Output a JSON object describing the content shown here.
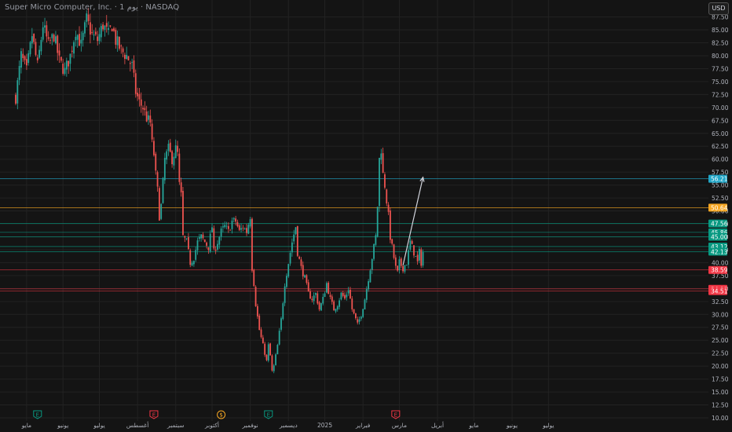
{
  "header": {
    "title": "Super Micro Computer, Inc. · 1 يوم · NASDAQ",
    "currency": "USD"
  },
  "colors": {
    "background": "#141414",
    "up": "#26a69a",
    "down": "#ef5350",
    "grid": "#222222",
    "axis_text": "#b2b5be",
    "label_cyan": "#21a6c7",
    "label_orange": "#f5a623",
    "label_green": "#089981",
    "label_red": "#f23645",
    "arrow": "#d1d4dc"
  },
  "chart_data": {
    "type": "candlestick",
    "ylim": [
      10,
      88.5
    ],
    "y_ticks": [
      {
        "value": 87.5,
        "label": "87.50"
      },
      {
        "value": 85,
        "label": "85.00"
      },
      {
        "value": 82.5,
        "label": "82.50"
      },
      {
        "value": 80,
        "label": "80.00"
      },
      {
        "value": 77.5,
        "label": "77.50"
      },
      {
        "value": 75,
        "label": "75.00"
      },
      {
        "value": 72.5,
        "label": "72.50"
      },
      {
        "value": 70,
        "label": "70.00"
      },
      {
        "value": 67.5,
        "label": "67.50"
      },
      {
        "value": 65,
        "label": "65.00"
      },
      {
        "value": 62.5,
        "label": "62.50"
      },
      {
        "value": 60,
        "label": "60.00"
      },
      {
        "value": 57.5,
        "label": "57.50"
      },
      {
        "value": 55,
        "label": "55.00"
      },
      {
        "value": 52.5,
        "label": "52.50"
      },
      {
        "value": 50,
        "label": "50.00"
      },
      {
        "value": 47.5,
        "label": "47.50"
      },
      {
        "value": 45,
        "label": "45.00"
      },
      {
        "value": 42.5,
        "label": "42.50"
      },
      {
        "value": 40,
        "label": "40.00"
      },
      {
        "value": 37.5,
        "label": "37.50"
      },
      {
        "value": 35,
        "label": "35.00"
      },
      {
        "value": 32.5,
        "label": "32.50"
      },
      {
        "value": 30,
        "label": "30.00"
      },
      {
        "value": 27.5,
        "label": "27.50"
      },
      {
        "value": 25,
        "label": "25.00"
      },
      {
        "value": 22.5,
        "label": "22.50"
      },
      {
        "value": 20,
        "label": "20.00"
      },
      {
        "value": 17.5,
        "label": "17.50"
      },
      {
        "value": 15,
        "label": "15.00"
      },
      {
        "value": 12.5,
        "label": "12.50"
      },
      {
        "value": 10,
        "label": "10.00"
      }
    ],
    "x_ticks": [
      {
        "label": "مايو",
        "i": 6
      },
      {
        "label": "يونيو",
        "i": 26
      },
      {
        "label": "يوليو",
        "i": 46
      },
      {
        "label": "أغسطس",
        "i": 67
      },
      {
        "label": "سبتمبر",
        "i": 88
      },
      {
        "label": "أكتوبر",
        "i": 108
      },
      {
        "label": "نوفمبر",
        "i": 129
      },
      {
        "label": "ديسمبر",
        "i": 150
      },
      {
        "label": "2025",
        "i": 170
      },
      {
        "label": "فبراير",
        "i": 191
      },
      {
        "label": "مارس",
        "i": 211
      },
      {
        "label": "أبريل",
        "i": 232
      },
      {
        "label": "مايو",
        "i": 252
      },
      {
        "label": "يونيو",
        "i": 273
      },
      {
        "label": "يوليو",
        "i": 293
      }
    ],
    "events": [
      {
        "i": 12,
        "type": "earnings",
        "label": "E",
        "color": "#089981"
      },
      {
        "i": 76,
        "type": "earnings",
        "label": "E",
        "color": "#f23645"
      },
      {
        "i": 113,
        "type": "dividend",
        "label": "$",
        "color": "#f5a623"
      },
      {
        "i": 139,
        "type": "earnings",
        "label": "E",
        "color": "#089981"
      },
      {
        "i": 209,
        "type": "earnings",
        "label": "E",
        "color": "#f23645"
      }
    ],
    "levels": [
      {
        "value": 56.21,
        "label": "56.21",
        "color": "#21a6c7"
      },
      {
        "value": 50.64,
        "label": "50.64",
        "color": "#f5a623"
      },
      {
        "value": 47.56,
        "label": "47.56",
        "color": "#089981"
      },
      {
        "value": 45.86,
        "label": "45.86",
        "color": "#089981"
      },
      {
        "value": 45.0,
        "label": "45.00",
        "color": "#089981"
      },
      {
        "value": 43.12,
        "label": "43.12",
        "color": "#089981"
      },
      {
        "value": 42.13,
        "label": "42.13",
        "color": "#089981"
      },
      {
        "value": 38.59,
        "label": "38.59",
        "color": "#f23645"
      },
      {
        "value": 34.93,
        "label": "34.93",
        "color": "#f23645"
      },
      {
        "value": 34.51,
        "label": "34.51",
        "color": "#f23645"
      }
    ],
    "arrow": {
      "from": {
        "i": 213,
        "value": 39.5
      },
      "to": {
        "i": 224,
        "value": 56.5
      }
    },
    "close_anchors": [
      [
        0,
        72
      ],
      [
        3,
        80
      ],
      [
        6,
        77
      ],
      [
        9,
        84
      ],
      [
        12,
        78
      ],
      [
        15,
        86
      ],
      [
        18,
        82
      ],
      [
        21,
        84
      ],
      [
        24,
        79
      ],
      [
        27,
        77
      ],
      [
        30,
        80
      ],
      [
        33,
        85
      ],
      [
        36,
        82
      ],
      [
        39,
        87
      ],
      [
        42,
        84
      ],
      [
        45,
        83
      ],
      [
        48,
        86
      ],
      [
        51,
        84
      ],
      [
        53,
        86
      ],
      [
        55,
        83
      ],
      [
        58,
        81
      ],
      [
        61,
        80
      ],
      [
        64,
        78
      ],
      [
        66,
        73
      ],
      [
        68,
        71
      ],
      [
        70,
        70
      ],
      [
        72,
        68
      ],
      [
        74,
        67
      ],
      [
        75,
        63
      ],
      [
        76,
        61
      ],
      [
        77,
        57
      ],
      [
        78,
        54
      ],
      [
        79,
        49
      ],
      [
        80,
        51
      ],
      [
        82,
        60
      ],
      [
        84,
        62
      ],
      [
        86,
        60
      ],
      [
        88,
        62
      ],
      [
        89,
        61
      ],
      [
        90,
        55
      ],
      [
        91,
        53
      ],
      [
        92,
        45
      ],
      [
        94,
        44
      ],
      [
        96,
        40
      ],
      [
        98,
        41
      ],
      [
        100,
        44
      ],
      [
        102,
        45
      ],
      [
        104,
        44
      ],
      [
        106,
        43
      ],
      [
        108,
        47
      ],
      [
        109,
        42
      ],
      [
        111,
        44
      ],
      [
        113,
        46
      ],
      [
        115,
        47
      ],
      [
        117,
        46
      ],
      [
        119,
        48
      ],
      [
        121,
        48
      ],
      [
        123,
        46
      ],
      [
        125,
        47
      ],
      [
        127,
        46
      ],
      [
        129,
        49
      ],
      [
        130,
        39
      ],
      [
        131,
        36
      ],
      [
        132,
        32
      ],
      [
        134,
        27
      ],
      [
        136,
        24
      ],
      [
        138,
        21
      ],
      [
        139,
        24
      ],
      [
        140,
        22
      ],
      [
        141,
        19
      ],
      [
        142,
        20
      ],
      [
        144,
        24
      ],
      [
        146,
        29
      ],
      [
        148,
        36
      ],
      [
        150,
        40
      ],
      [
        152,
        44
      ],
      [
        154,
        47
      ],
      [
        155,
        42
      ],
      [
        157,
        39
      ],
      [
        159,
        37
      ],
      [
        161,
        34
      ],
      [
        163,
        33
      ],
      [
        165,
        34
      ],
      [
        167,
        31
      ],
      [
        169,
        33
      ],
      [
        171,
        36
      ],
      [
        173,
        33
      ],
      [
        175,
        31
      ],
      [
        177,
        32
      ],
      [
        179,
        34
      ],
      [
        181,
        33
      ],
      [
        183,
        35
      ],
      [
        185,
        31
      ],
      [
        187,
        29
      ],
      [
        188,
        28
      ],
      [
        190,
        30
      ],
      [
        192,
        33
      ],
      [
        194,
        37
      ],
      [
        196,
        41
      ],
      [
        198,
        45
      ],
      [
        199,
        51
      ],
      [
        200,
        60
      ],
      [
        201,
        62
      ],
      [
        202,
        57
      ],
      [
        203,
        55
      ],
      [
        204,
        52
      ],
      [
        205,
        49
      ],
      [
        206,
        45
      ],
      [
        207,
        43
      ],
      [
        208,
        41
      ],
      [
        209,
        39
      ],
      [
        210,
        38
      ],
      [
        211,
        40
      ],
      [
        213,
        39
      ],
      [
        215,
        40
      ],
      [
        217,
        44
      ],
      [
        219,
        42
      ],
      [
        221,
        40
      ],
      [
        222,
        42
      ],
      [
        223,
        40
      ],
      [
        224,
        42
      ]
    ]
  }
}
